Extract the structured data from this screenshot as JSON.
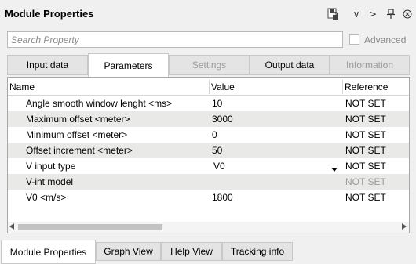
{
  "title": "Module Properties",
  "toolbar": {
    "icons": [
      "save-lock-icon",
      "chevron-down-icon",
      "chevron-right-icon",
      "pin-icon",
      "close-icon"
    ],
    "chevron_down": "∨",
    "chevron_right": ">",
    "pin": "⊥",
    "close": "⊗"
  },
  "search": {
    "placeholder": "Search Property"
  },
  "advanced": {
    "label": "Advanced",
    "checked": false,
    "enabled": false
  },
  "tabs": [
    {
      "label": "Input data",
      "active": false,
      "enabled": true
    },
    {
      "label": "Parameters",
      "active": true,
      "enabled": true
    },
    {
      "label": "Settings",
      "active": false,
      "enabled": false
    },
    {
      "label": "Output data",
      "active": false,
      "enabled": true
    },
    {
      "label": "Information",
      "active": false,
      "enabled": false
    }
  ],
  "table": {
    "columns": [
      "Name",
      "Value",
      "Reference"
    ],
    "rows": [
      {
        "name": "Angle smooth window lenght <ms>",
        "value": "10",
        "reference": "NOT SET"
      },
      {
        "name": "Maximum offset <meter>",
        "value": "3000",
        "reference": "NOT SET"
      },
      {
        "name": "Minimum offset <meter>",
        "value": "0",
        "reference": "NOT SET"
      },
      {
        "name": "Offset increment <meter>",
        "value": "50",
        "reference": "NOT SET"
      },
      {
        "name": "V input type",
        "value": "V0",
        "reference": "NOT SET",
        "dropdown": true
      },
      {
        "name": "V-int model",
        "value": "",
        "reference": "NOT SET",
        "disabled_ref": true
      },
      {
        "name": "V0 <m/s>",
        "value": "1800",
        "reference": "NOT SET"
      }
    ]
  },
  "bottom_tabs": [
    {
      "label": "Module Properties",
      "active": true
    },
    {
      "label": "Graph View",
      "active": false
    },
    {
      "label": "Help View",
      "active": false
    },
    {
      "label": "Tracking info",
      "active": false
    }
  ]
}
